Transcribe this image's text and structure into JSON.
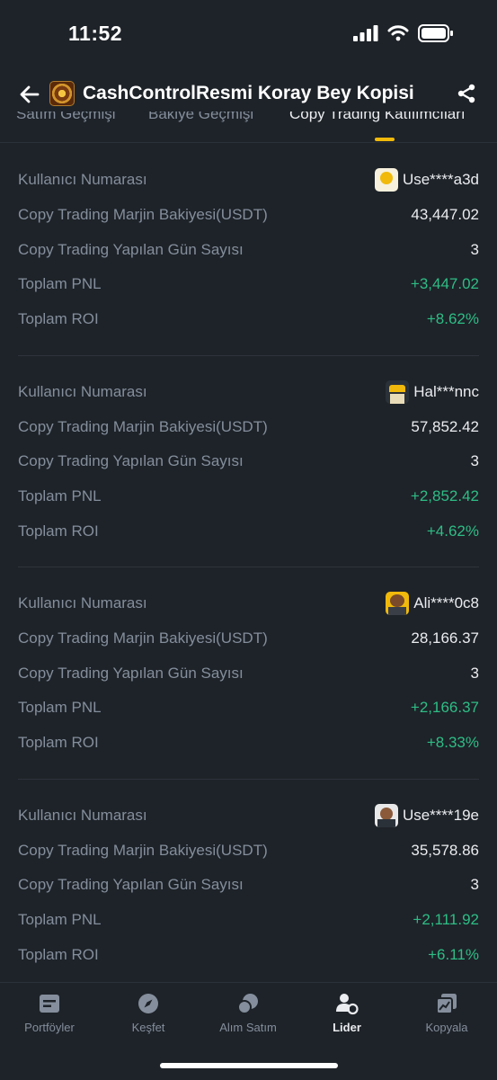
{
  "status": {
    "time": "11:52"
  },
  "header": {
    "title": "CashControlResmi Koray Bey Kopisi"
  },
  "tabs": [
    {
      "label": "Satım Geçmişi"
    },
    {
      "label": "Bakiye Geçmişi"
    },
    {
      "label": "Copy Trading Katılımcıları",
      "active": true
    }
  ],
  "participants": [
    {
      "user_label": "Kullanıcı Numarası",
      "user": "Use****a3d",
      "margin_label": "Copy Trading Marjin Bakiyesi(USDT)",
      "margin": "43,447.02",
      "days_label": "Copy Trading Yapılan Gün Sayısı",
      "days": "3",
      "pnl_label": "Toplam PNL",
      "pnl": "+3,447.02",
      "roi_label": "Toplam ROI",
      "roi": "+8.62%"
    },
    {
      "user_label": "Kullanıcı Numarası",
      "user": "Hal***nnc",
      "margin_label": "Copy Trading Marjin Bakiyesi(USDT)",
      "margin": "57,852.42",
      "days_label": "Copy Trading Yapılan Gün Sayısı",
      "days": "3",
      "pnl_label": "Toplam PNL",
      "pnl": "+2,852.42",
      "roi_label": "Toplam ROI",
      "roi": "+4.62%"
    },
    {
      "user_label": "Kullanıcı Numarası",
      "user": "Ali****0c8",
      "margin_label": "Copy Trading Marjin Bakiyesi(USDT)",
      "margin": "28,166.37",
      "days_label": "Copy Trading Yapılan Gün Sayısı",
      "days": "3",
      "pnl_label": "Toplam PNL",
      "pnl": "+2,166.37",
      "roi_label": "Toplam ROI",
      "roi": "+8.33%"
    },
    {
      "user_label": "Kullanıcı Numarası",
      "user": "Use****19e",
      "margin_label": "Copy Trading Marjin Bakiyesi(USDT)",
      "margin": "35,578.86",
      "days_label": "Copy Trading Yapılan Gün Sayısı",
      "days": "3",
      "pnl_label": "Toplam PNL",
      "pnl": "+2,111.92",
      "roi_label": "Toplam ROI",
      "roi": "+6.11%"
    }
  ],
  "nav": [
    {
      "label": "Portföyler",
      "icon": "portfolio-icon"
    },
    {
      "label": "Keşfet",
      "icon": "compass-icon"
    },
    {
      "label": "Alım Satım",
      "icon": "trade-icon"
    },
    {
      "label": "Lider",
      "icon": "leader-icon",
      "active": true
    },
    {
      "label": "Kopyala",
      "icon": "copy-chart-icon"
    }
  ],
  "colors": {
    "background": "#1e2329",
    "positive": "#2ebd85",
    "accent": "#f0b90b",
    "muted": "#848e9c"
  }
}
